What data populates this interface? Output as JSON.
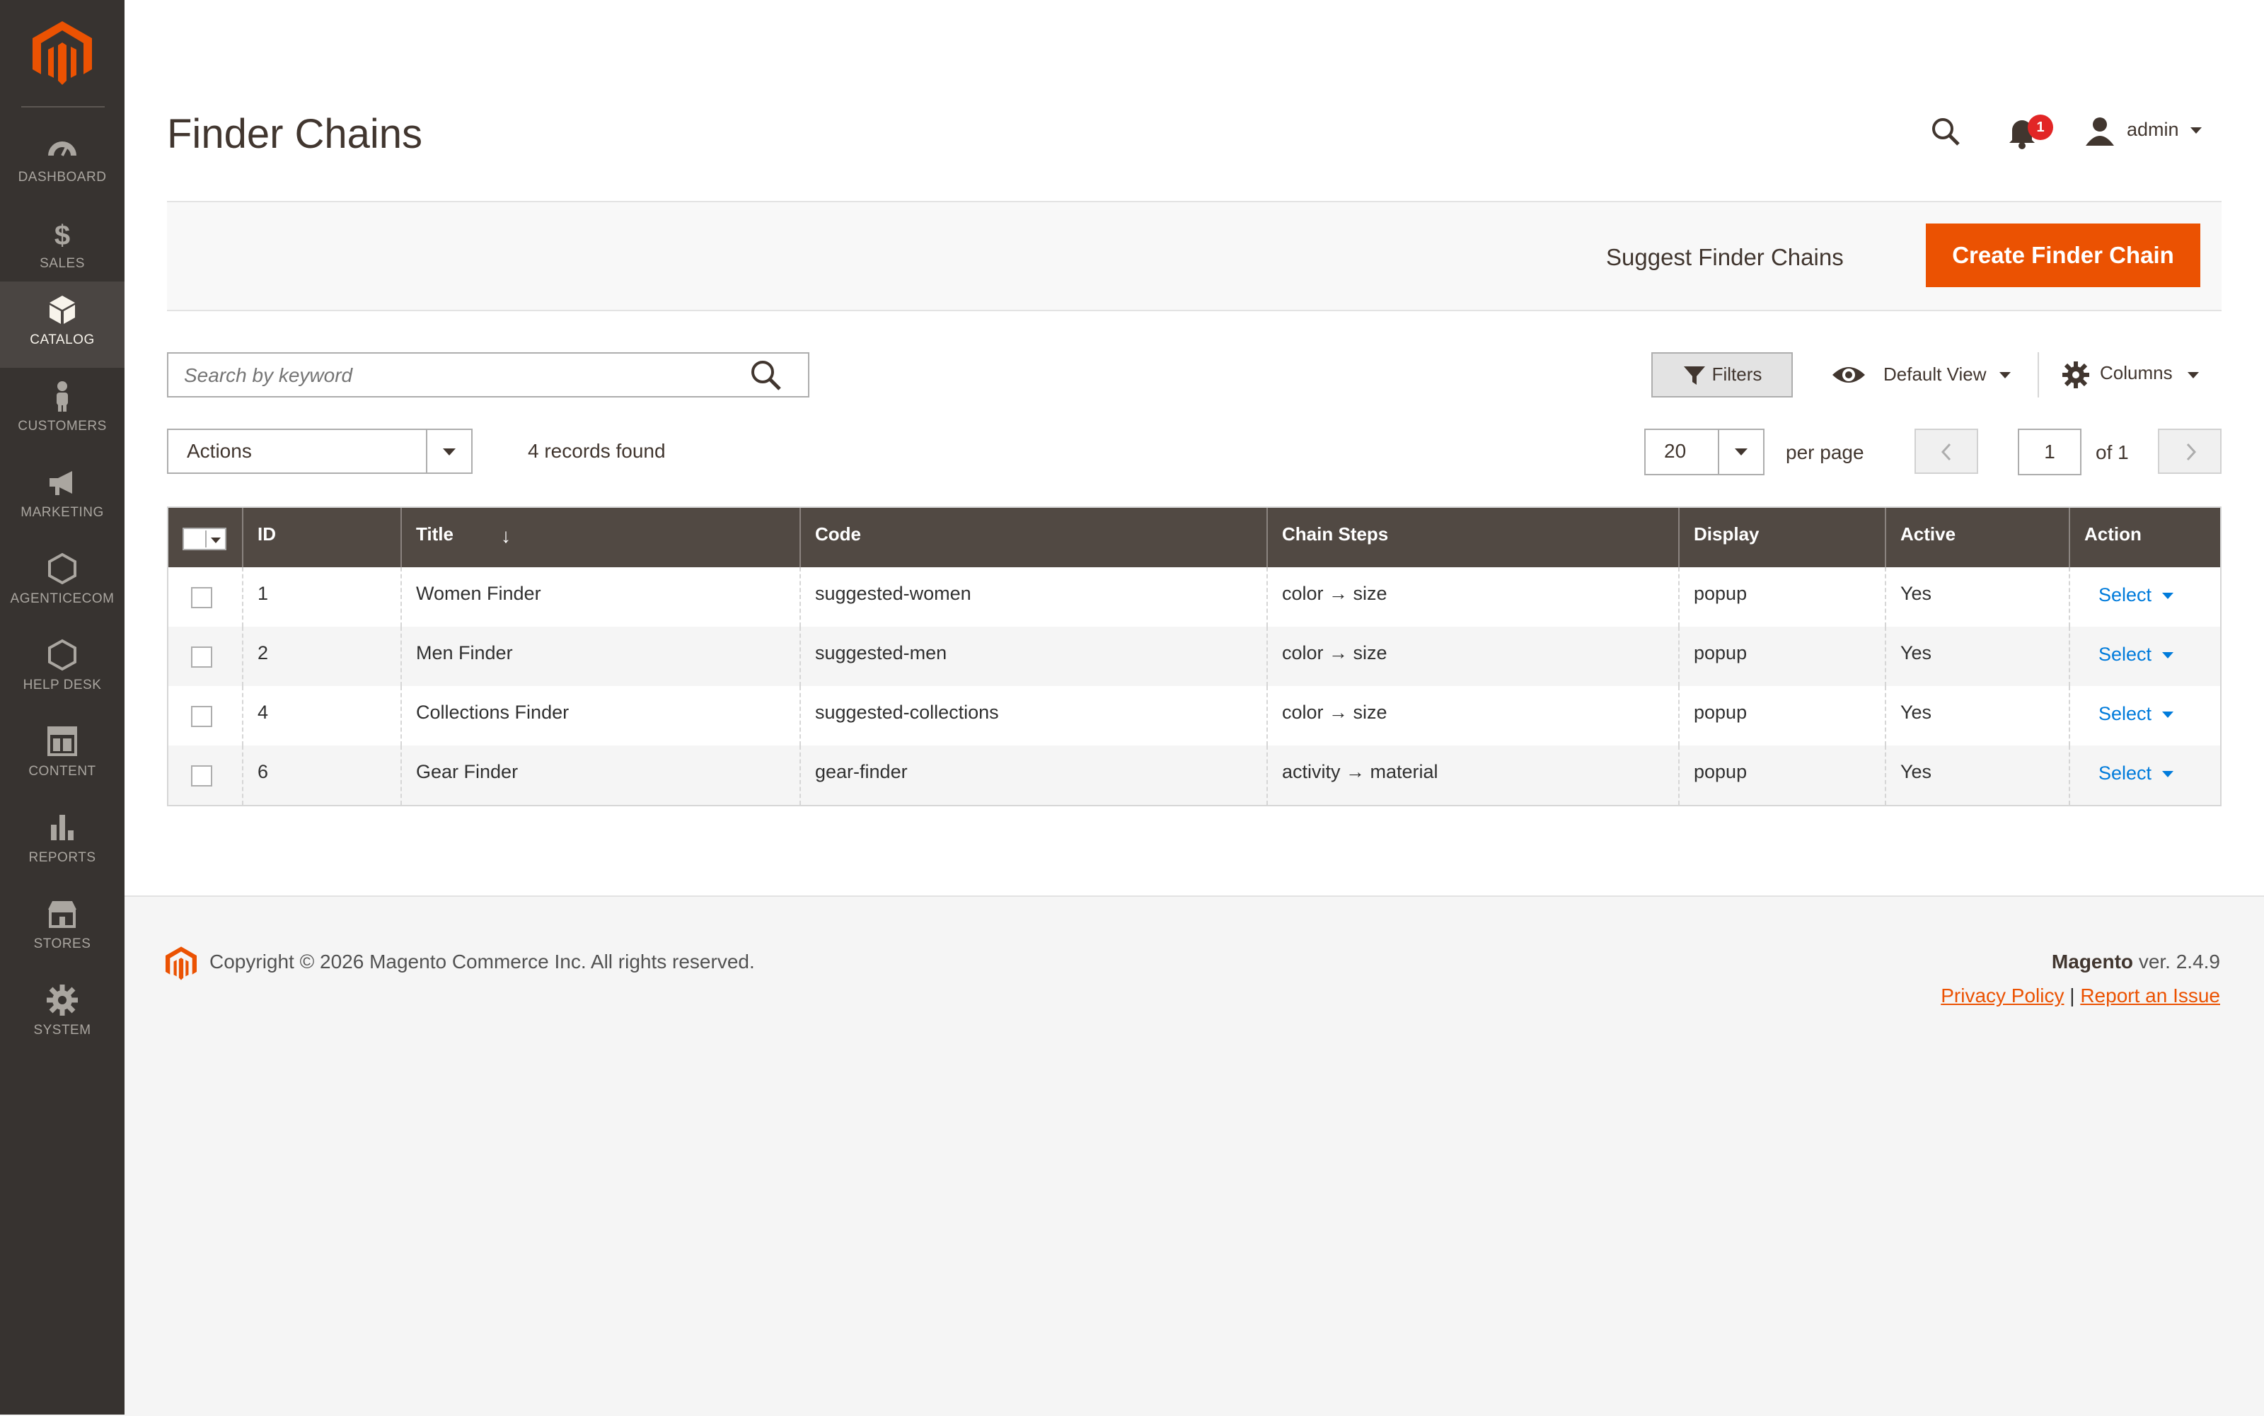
{
  "sidebar": {
    "items": [
      {
        "label": "DASHBOARD",
        "icon": "dashboard-icon"
      },
      {
        "label": "SALES",
        "icon": "dollar-icon"
      },
      {
        "label": "CATALOG",
        "icon": "catalog-box-icon",
        "active": true
      },
      {
        "label": "CUSTOMERS",
        "icon": "customer-icon"
      },
      {
        "label": "MARKETING",
        "icon": "megaphone-icon"
      },
      {
        "label": "AGENTICECOM",
        "icon": "hexagon-icon"
      },
      {
        "label": "HELP DESK",
        "icon": "hexagon-icon"
      },
      {
        "label": "CONTENT",
        "icon": "content-layout-icon"
      },
      {
        "label": "REPORTS",
        "icon": "bar-chart-icon"
      },
      {
        "label": "STORES",
        "icon": "store-icon"
      },
      {
        "label": "SYSTEM",
        "icon": "gear-icon"
      }
    ]
  },
  "header": {
    "title": "Finder Chains",
    "notifications_count": "1",
    "user": "admin"
  },
  "action_bar": {
    "suggest_label": "Suggest Finder Chains",
    "create_label": "Create Finder Chain"
  },
  "toolbar": {
    "search_placeholder": "Search by keyword",
    "filters_label": "Filters",
    "view_label": "Default View",
    "columns_label": "Columns",
    "actions_label": "Actions",
    "records_found": "4 records found",
    "per_page_value": "20",
    "per_page_label": "per page",
    "page_current": "1",
    "page_of": "of 1"
  },
  "grid": {
    "columns": [
      "ID",
      "Title",
      "Code",
      "Chain Steps",
      "Display",
      "Active",
      "Action"
    ],
    "rows": [
      {
        "id": "1",
        "title": "Women Finder",
        "code": "suggested-women",
        "steps": "color → size",
        "display": "popup",
        "active": "Yes",
        "action": "Select"
      },
      {
        "id": "2",
        "title": "Men Finder",
        "code": "suggested-men",
        "steps": "color → size",
        "display": "popup",
        "active": "Yes",
        "action": "Select"
      },
      {
        "id": "4",
        "title": "Collections Finder",
        "code": "suggested-collections",
        "steps": "color → size",
        "display": "popup",
        "active": "Yes",
        "action": "Select"
      },
      {
        "id": "6",
        "title": "Gear Finder",
        "code": "gear-finder",
        "steps": "activity → material",
        "display": "popup",
        "active": "Yes",
        "action": "Select"
      }
    ]
  },
  "footer": {
    "copyright": "Copyright © 2026 Magento Commerce Inc. All rights reserved.",
    "brand": "Magento",
    "version": "ver. 2.4.9",
    "privacy": "Privacy Policy",
    "separator": "|",
    "report": "Report an Issue"
  },
  "colors": {
    "accent": "#eb5202",
    "sidebar": "#373330",
    "grid_header": "#514943",
    "link": "#007bdb"
  }
}
